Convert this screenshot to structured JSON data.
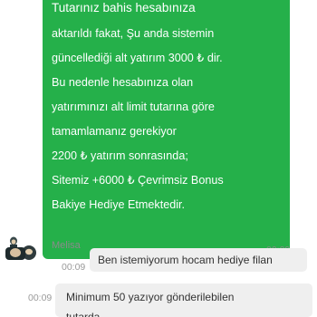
{
  "incoming_message": {
    "lines": [
      "Tutarınız bahis hesabınıza",
      "aktarıldı fakat, Şu anda sistemin",
      "güncellediği alt yatırım 3000 ₺ dir.",
      "Bu nedenle hesabınıza olan",
      "yatırımınızı alt limit tutarına göre",
      "tamamlamanız gerekiyor",
      "2200 ₺ yatırım sonrasında;",
      "Sitemiz +6000 ₺ Çevrimsiz Bonus",
      "Bakiye Hediye Etmektedir."
    ],
    "time": "00:09",
    "sender": "Melisa",
    "bubble_color": "#25b04a"
  },
  "outgoing_messages": [
    {
      "text": "Ben istemiyorum hocam hediye filan",
      "time": "00:09"
    },
    {
      "lines": [
        "Minimum 50 yazıyor gönderilebilen",
        "tutarda"
      ],
      "time": "00:09"
    }
  ]
}
